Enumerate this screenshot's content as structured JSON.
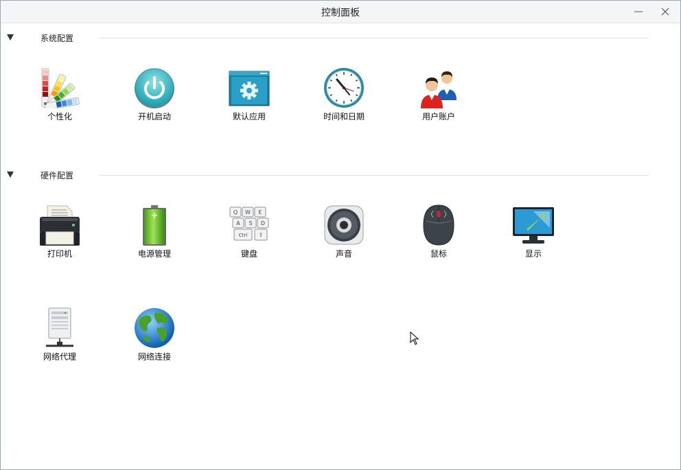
{
  "window": {
    "title": "控制面板",
    "minimize_label": "—",
    "close_label": "✕"
  },
  "sections": [
    {
      "title": "系统配置",
      "items": [
        {
          "label": "个性化",
          "icon": "color-palette-icon"
        },
        {
          "label": "开机启动",
          "icon": "power-icon"
        },
        {
          "label": "默认应用",
          "icon": "default-app-gear-icon"
        },
        {
          "label": "时间和日期",
          "icon": "clock-icon"
        },
        {
          "label": "用户账户",
          "icon": "users-icon"
        }
      ]
    },
    {
      "title": "硬件配置",
      "items": [
        {
          "label": "打印机",
          "icon": "printer-icon"
        },
        {
          "label": "电源管理",
          "icon": "battery-icon"
        },
        {
          "label": "键盘",
          "icon": "keyboard-icon"
        },
        {
          "label": "声音",
          "icon": "speaker-icon"
        },
        {
          "label": "鼠标",
          "icon": "mouse-icon"
        },
        {
          "label": "显示",
          "icon": "monitor-icon"
        },
        {
          "label": "网络代理",
          "icon": "network-proxy-icon"
        },
        {
          "label": "网络连接",
          "icon": "globe-icon"
        }
      ]
    }
  ],
  "keyboard_keys": {
    "q": "Q",
    "w": "W",
    "e": "E",
    "a": "A",
    "s": "S",
    "d": "D",
    "ctrl": "Ctrl",
    "shift": "⇧"
  }
}
